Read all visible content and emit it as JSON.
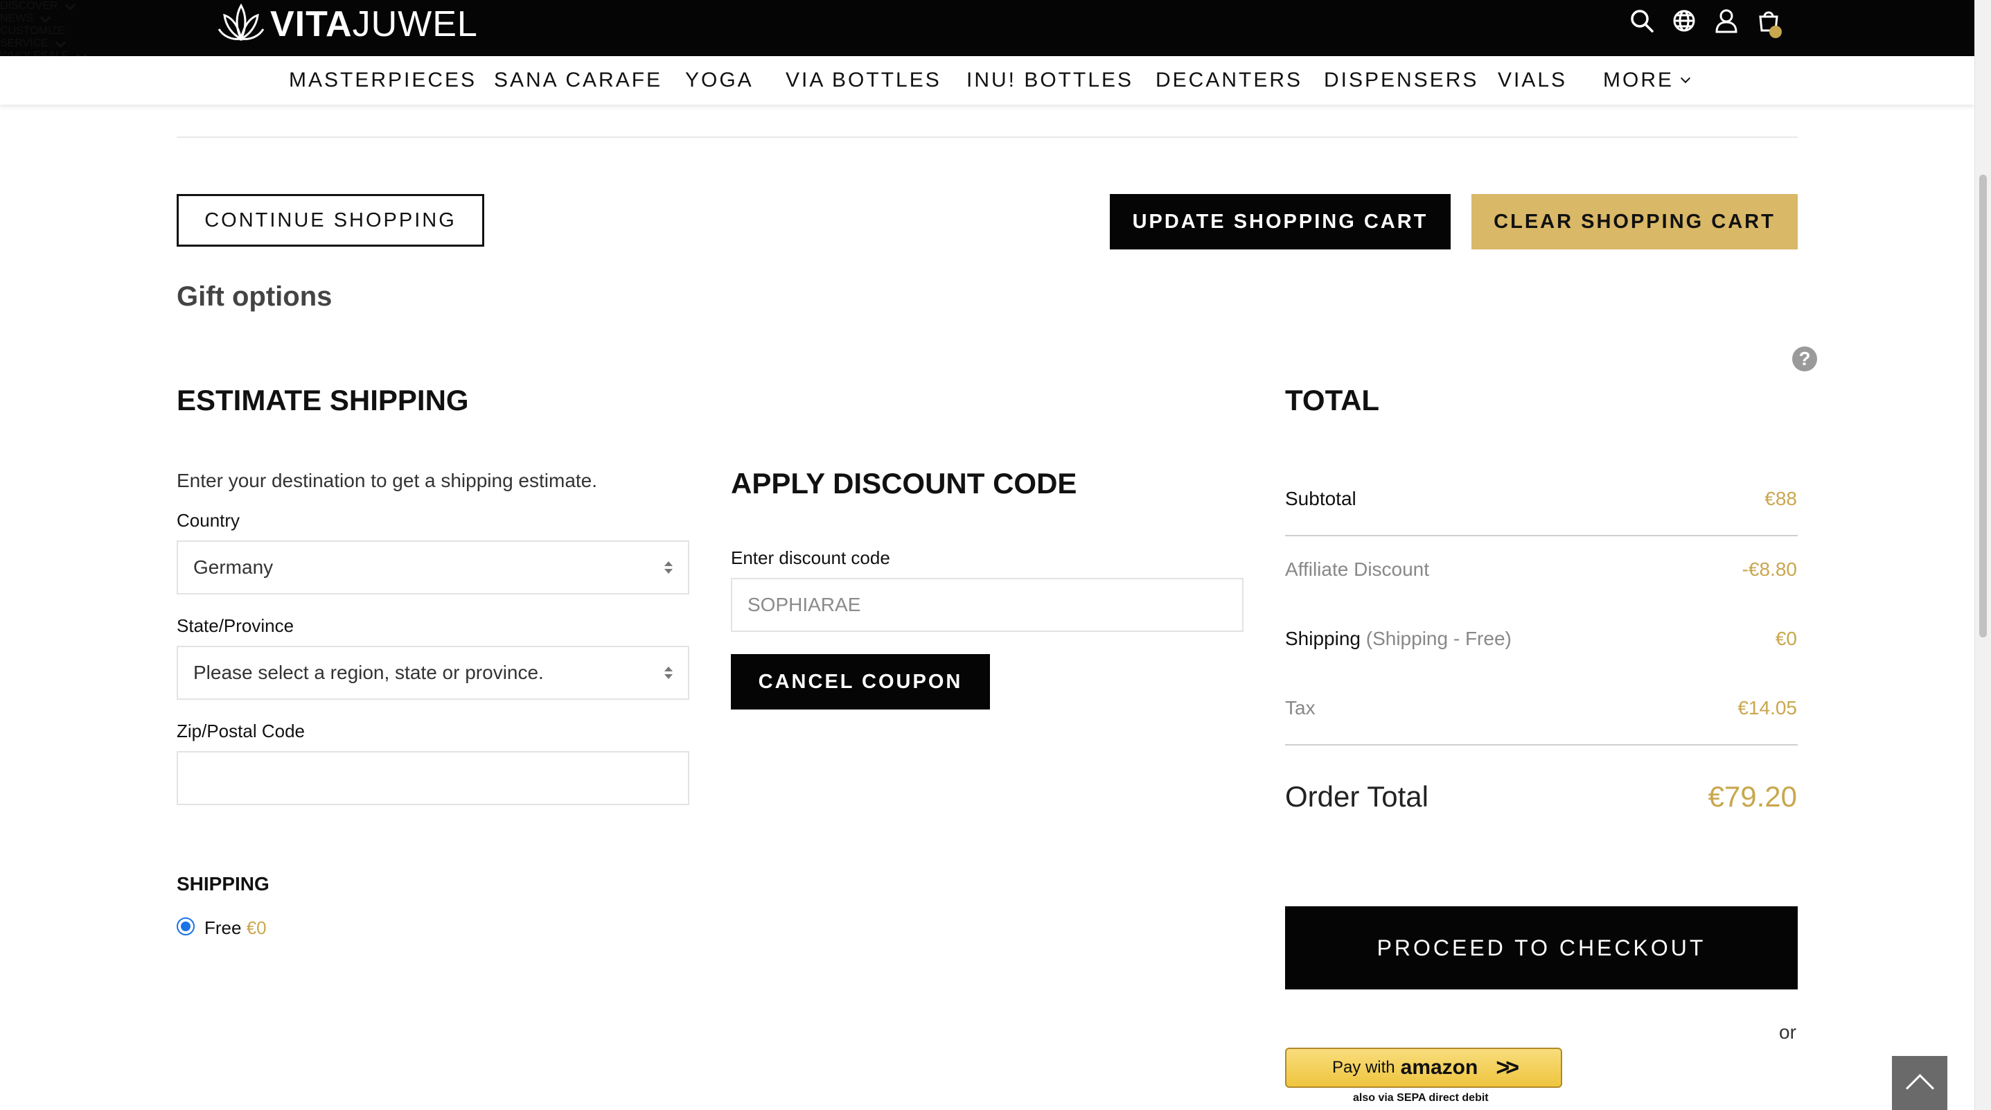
{
  "header": {
    "logo": {
      "bold": "VITA",
      "light": "JUWEL"
    },
    "nav": [
      {
        "label": "DISCOVER",
        "dropdown": true
      },
      {
        "label": "NEWS",
        "dropdown": true
      },
      {
        "label": "CUSTOMIZE",
        "dropdown": false
      },
      {
        "label": "SERVICE",
        "dropdown": true
      },
      {
        "label": "WHOLESALE",
        "dropdown": true
      }
    ],
    "icons": [
      "search-icon",
      "globe-icon",
      "user-icon",
      "cart-icon"
    ],
    "subnav": [
      {
        "label": "MASTERPIECES"
      },
      {
        "label": "SANA CARAFE"
      },
      {
        "label": "YOGA"
      },
      {
        "label": "VIA BOTTLES"
      },
      {
        "label": "INU! BOTTLES"
      },
      {
        "label": "DECANTERS"
      },
      {
        "label": "DISPENSERS"
      },
      {
        "label": "VIALS"
      },
      {
        "label": "MORE",
        "dropdown": true
      }
    ]
  },
  "cart_actions": {
    "continue": "CONTINUE SHOPPING",
    "update": "UPDATE SHOPPING CART",
    "clear": "CLEAR SHOPPING CART"
  },
  "gift": {
    "title": "Gift options"
  },
  "shipping_estimate": {
    "title": "ESTIMATE SHIPPING",
    "description": "Enter your destination to get a shipping estimate.",
    "country_label": "Country",
    "country_value": "Germany",
    "state_label": "State/Province",
    "state_value": "Please select a region, state or province.",
    "zip_label": "Zip/Postal Code",
    "zip_value": "",
    "shipping_title": "SHIPPING",
    "method_label": "Free",
    "method_price": "€0"
  },
  "discount": {
    "title": "APPLY DISCOUNT CODE",
    "label": "Enter discount code",
    "placeholder": "SOPHIARAE",
    "cancel": "CANCEL COUPON"
  },
  "totals": {
    "title": "TOTAL",
    "help": "?",
    "subtotal_label": "Subtotal",
    "subtotal_value": "€88",
    "affiliate_label": "Affiliate Discount",
    "affiliate_value": "-€8.80",
    "shipping_label": "Shipping",
    "shipping_note": "(Shipping - Free)",
    "shipping_value": "€0",
    "tax_label": "Tax",
    "tax_value": "€14.05",
    "order_total_label": "Order Total",
    "order_total_value": "€79.20",
    "checkout": "PROCEED TO CHECKOUT",
    "or": "or",
    "amazon_pay": "Pay with",
    "amazon_brand": "amazon",
    "amazon_sub": "also via SEPA direct debit"
  },
  "colors": {
    "gold": "#c9a74e",
    "button_gold": "#d9b867",
    "black": "#050505",
    "radio": "#1a73e8"
  }
}
